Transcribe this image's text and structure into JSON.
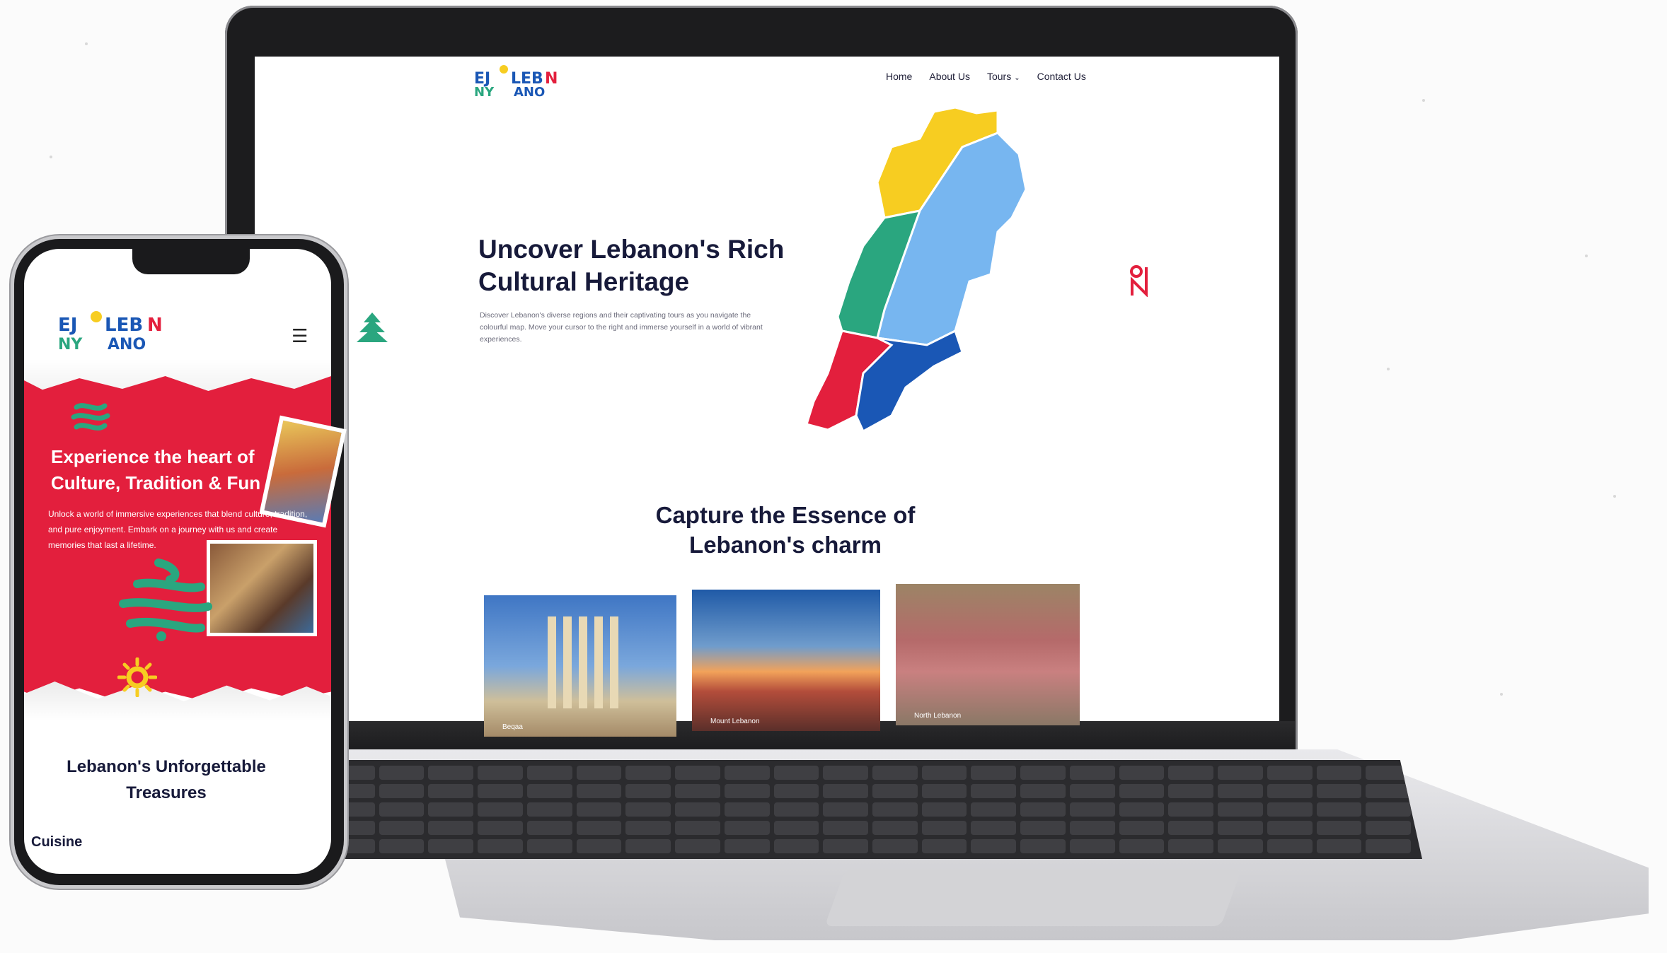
{
  "site": {
    "logo_text": "ENJOY LEBANON",
    "nav": [
      {
        "label": "Home"
      },
      {
        "label": "About Us"
      },
      {
        "label": "Tours"
      },
      {
        "label": "Contact Us"
      }
    ],
    "hero": {
      "title": "Uncover Lebanon's Rich Cultural Heritage",
      "description": "Discover Lebanon's diverse regions and their captivating tours as you navigate the colourful map. Move your cursor to the right and immerse yourself in a world of vibrant experiences."
    },
    "map_regions": [
      {
        "color": "#f7cd21"
      },
      {
        "color": "#77b6f0"
      },
      {
        "color": "#2aa67f"
      },
      {
        "color": "#e31f3d"
      },
      {
        "color": "#1a57b5"
      }
    ],
    "section_title": "Capture the Essence of Lebanon's charm",
    "cards": [
      {
        "label": "Beqaa"
      },
      {
        "label": "Mount Lebanon"
      },
      {
        "label": "North Lebanon"
      }
    ]
  },
  "mobile": {
    "logo_text": "ENJOY LEBANON",
    "menu_icon": "hamburger-icon",
    "hero_title": "Experience the heart of Culture, Tradition & Fun",
    "hero_description": "Unlock a world of immersive experiences that blend culture, tradition, and pure enjoyment. Embark on a journey with us and create memories that last a lifetime.",
    "section_title": "Lebanon's Unforgettable Treasures",
    "category": "Cuisine"
  },
  "colors": {
    "brand_red": "#e31f3d",
    "brand_blue": "#1a57b5",
    "brand_green": "#2aa67f",
    "brand_yellow": "#f7cd21",
    "text_dark": "#171a3a"
  }
}
